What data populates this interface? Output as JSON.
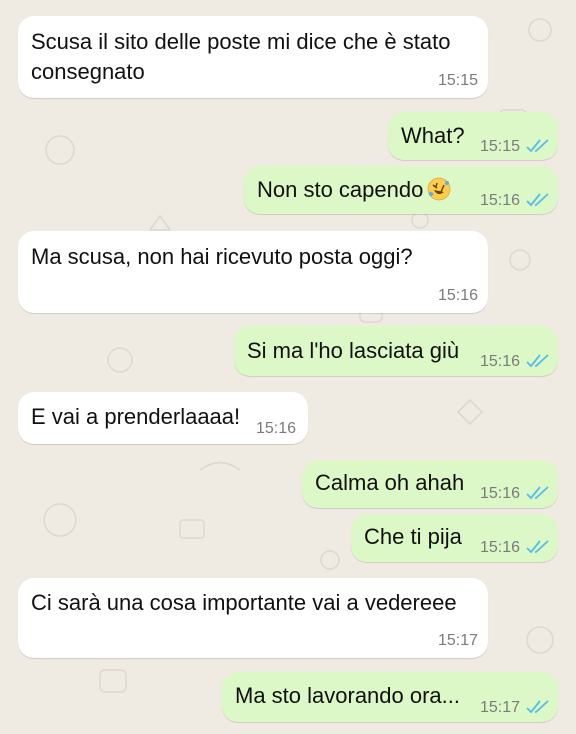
{
  "messages": [
    {
      "side": "in",
      "text": "Scusa il sito delle poste mi dice che è stato",
      "text2": "consegnato",
      "time": "15:15"
    },
    {
      "side": "out",
      "text": "What?",
      "time": "15:15",
      "status": "read"
    },
    {
      "side": "out",
      "text": "Non sto capendo",
      "emoji": "rolling-on-the-floor-laughing-emoji",
      "time": "15:16",
      "status": "read"
    },
    {
      "side": "in",
      "text": "Ma scusa, non hai ricevuto posta oggi?",
      "time": "15:16"
    },
    {
      "side": "out",
      "text": "Si ma l'ho lasciata giù",
      "time": "15:16",
      "status": "read"
    },
    {
      "side": "in",
      "text": "E vai a prenderlaaaa!",
      "time": "15:16"
    },
    {
      "side": "out",
      "text": "Calma oh ahah",
      "time": "15:16",
      "status": "read"
    },
    {
      "side": "out",
      "text": "Che ti pija",
      "time": "15:16",
      "status": "read"
    },
    {
      "side": "in",
      "text": "Ci sarà una cosa importante vai a vedereee",
      "time": "15:17"
    },
    {
      "side": "out",
      "text": "Ma sto lavorando ora...",
      "time": "15:17",
      "status": "read"
    }
  ],
  "colors": {
    "background": "#efeae2",
    "incoming_bubble": "#ffffff",
    "outgoing_bubble": "#dcf8c6",
    "read_ticks": "#53bdeb",
    "time_text": "#7b7b7b"
  }
}
